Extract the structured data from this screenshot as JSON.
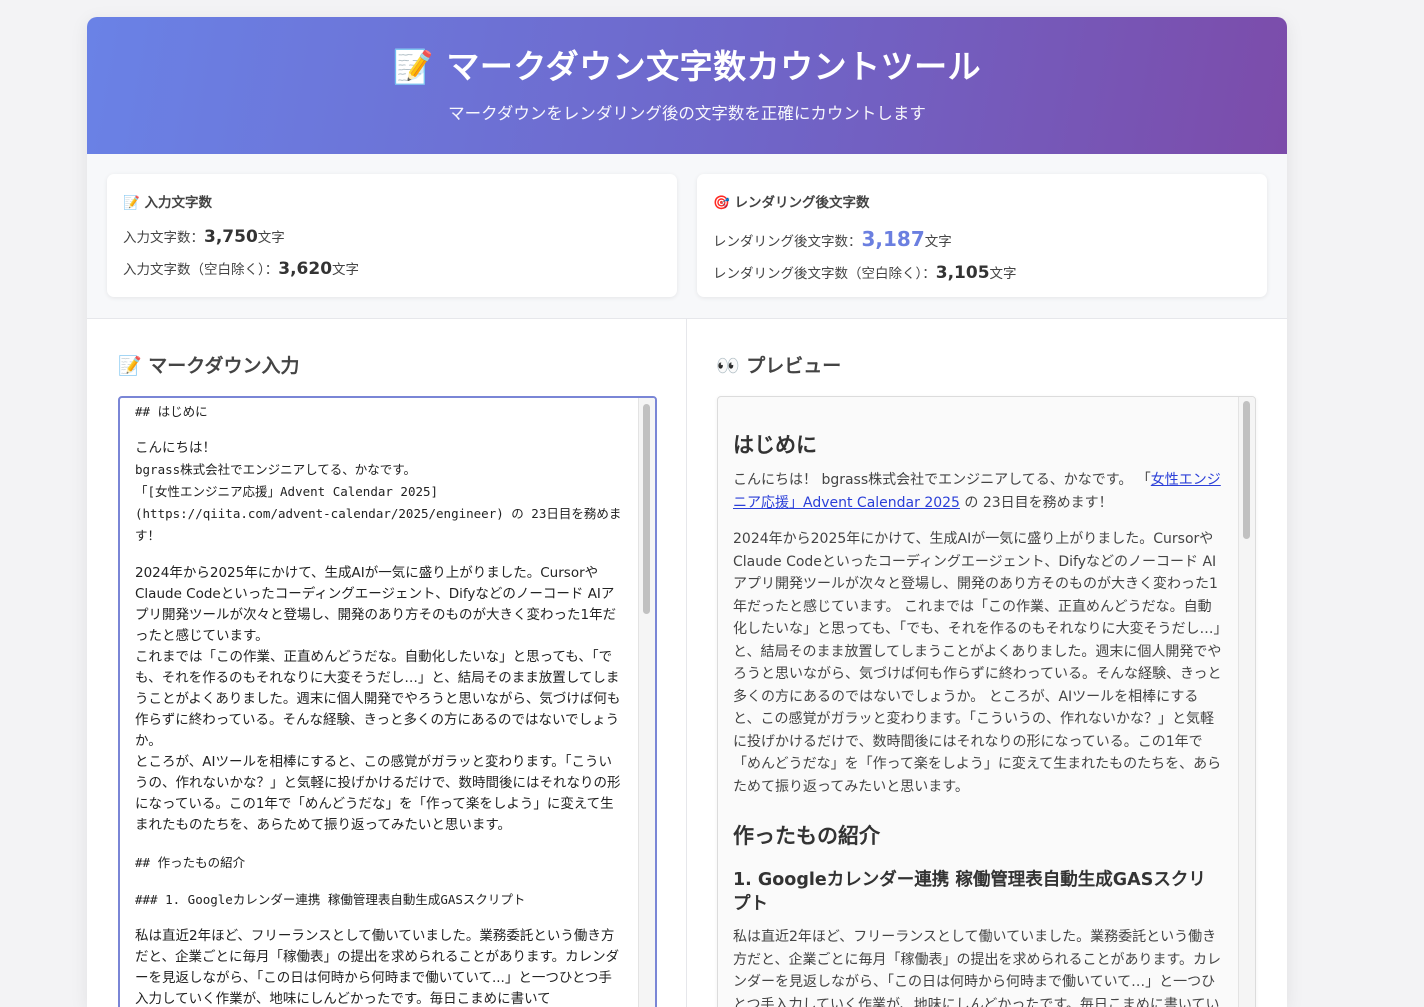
{
  "header": {
    "title": "📝 マークダウン文字数カウントツール",
    "subtitle": "マークダウンをレンダリング後の文字数を正確にカウントします"
  },
  "stats": {
    "input": {
      "title": "📝 入力文字数",
      "count_label": "入力文字数：",
      "count_value": "3,750",
      "count_unit": "文字",
      "nospace_label": "入力文字数（空白除く）：",
      "nospace_value": "3,620",
      "nospace_unit": "文字"
    },
    "rendered": {
      "title": "🎯 レンダリング後文字数",
      "count_label": "レンダリング後文字数：",
      "count_value": "3,187",
      "count_unit": "文字",
      "nospace_label": "レンダリング後文字数（空白除く）：",
      "nospace_value": "3,105",
      "nospace_unit": "文字"
    }
  },
  "editor": {
    "title": "📝 マークダウン入力",
    "h_intro": "## はじめに",
    "p1_a": "こんにちは！",
    "p1_b": "bgrass株式会社でエンジニアしてる、かなです。",
    "p1_c": "「[女性エンジニア応援」Advent Calendar 2025](https://qiita.com/advent-calendar/2025/engineer) の 23日目を務めます！",
    "p2": "2024年から2025年にかけて、生成AIが一気に盛り上がりました。CursorやClaude Codeといったコーディングエージェント、Difyなどのノーコード AIアプリ開発ツールが次々と登場し、開発のあり方そのものが大きく変わった1年だったと感じています。",
    "p3": "これまでは「この作業、正直めんどうだな。自動化したいな」と思っても、「でも、それを作るのもそれなりに大変そうだし…」と、結局そのまま放置してしまうことがよくありました。週末に個人開発でやろうと思いながら、気づけば何も作らずに終わっている。そんな経験、きっと多くの方にあるのではないでしょうか。",
    "p4": "ところが、AIツールを相棒にすると、この感覚がガラッと変わります。「こういうの、作れないかな？」と気軽に投げかけるだけで、数時間後にはそれなりの形になっている。この1年で「めんどうだな」を「作って楽をしよう」に変えて生まれたものたちを、あらためて振り返ってみたいと思います。",
    "h_made": "## 作ったもの紹介",
    "h_gas": "### 1. Googleカレンダー連携 稼働管理表自動生成GASスクリプト",
    "p5": "私は直近2年ほど、フリーランスとして働いていました。業務委託という働き方だと、企業ごとに毎月「稼働表」の提出を求められることがあります。カレンダーを見返しながら、「この日は何時から何時まで働いていて...」と一つひとつ手入力していく作業が、地味にしんどかったです。毎日こまめに書いて"
  },
  "preview": {
    "title": "👀 プレビュー",
    "h_intro": "はじめに",
    "p1_a": "こんにちは！ bgrass株式会社でエンジニアしてる、かなです。 「",
    "p1_link": "女性エンジニア応援」Advent Calendar 2025",
    "p1_b": " の 23日目を務めます！",
    "p2": "2024年から2025年にかけて、生成AIが一気に盛り上がりました。CursorやClaude Codeといったコーディングエージェント、Difyなどのノーコード AIアプリ開発ツールが次々と登場し、開発のあり方そのものが大きく変わった1年だったと感じています。 これまでは「この作業、正直めんどうだな。自動化したいな」と思っても、「でも、それを作るのもそれなりに大変そうだし…」と、結局そのまま放置してしまうことがよくありました。週末に個人開発でやろうと思いながら、気づけば何も作らずに終わっている。そんな経験、きっと多くの方にあるのではないでしょうか。 ところが、AIツールを相棒にすると、この感覚がガラッと変わります。「こういうの、作れないかな？」と気軽に投げかけるだけで、数時間後にはそれなりの形になっている。この1年で「めんどうだな」を「作って楽をしよう」に変えて生まれたものたちを、あらためて振り返ってみたいと思います。",
    "h_made": "作ったもの紹介",
    "h_gas": "1. Googleカレンダー連携 稼働管理表自動生成GASスクリプト",
    "p5": "私は直近2年ほど、フリーランスとして働いていました。業務委託という働き方だと、企業ごとに毎月「稼働表」の提出を求められることがあります。カレンダーを見返しながら、「この日は何時から何時まで働いていて…」と一つひとつ手入力していく作業が、地味にしんどかったです。毎日こまめに書いていく"
  },
  "colors": {
    "header_start": "#6a82e6",
    "header_end": "#7c4caa",
    "accent": "#6b7fe0",
    "link": "#2b3fd8",
    "editor_border": "#7a86d6"
  }
}
